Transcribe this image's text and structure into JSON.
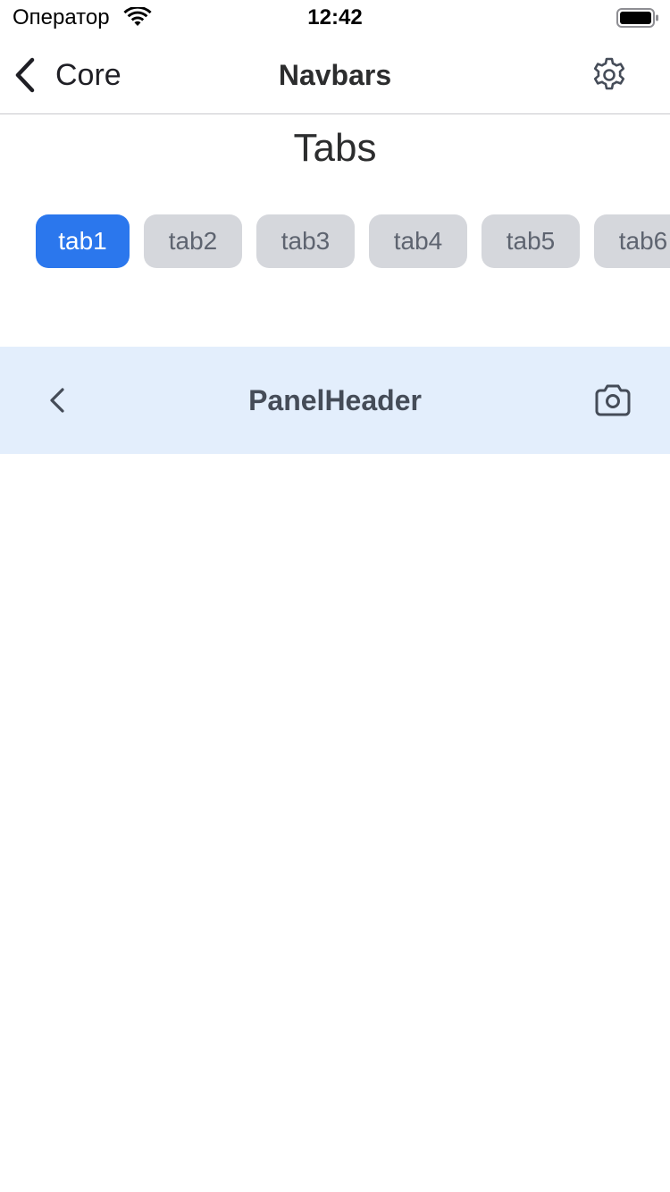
{
  "status_bar": {
    "carrier": "Оператор",
    "time": "12:42",
    "icons": [
      "wifi-icon",
      "battery-icon"
    ]
  },
  "navbar": {
    "back_label": "Core",
    "title": "Navbars",
    "icons": {
      "back": "chevron-left-icon",
      "settings": "gear-icon"
    }
  },
  "section": {
    "title": "Tabs"
  },
  "tabs": [
    {
      "label": "tab1",
      "selected": true
    },
    {
      "label": "tab2",
      "selected": false
    },
    {
      "label": "tab3",
      "selected": false
    },
    {
      "label": "tab4",
      "selected": false
    },
    {
      "label": "tab5",
      "selected": false
    },
    {
      "label": "tab6",
      "selected": false
    }
  ],
  "panel_header": {
    "title": "PanelHeader",
    "icons": {
      "back": "chevron-left-icon",
      "right": "camera-icon"
    }
  },
  "colors": {
    "accent": "#2b77ed",
    "tab_inactive_bg": "#d5d7dc",
    "tab_inactive_text": "#5e6470",
    "panel_header_bg": "#e3eefc",
    "panel_header_text": "#454c58"
  }
}
